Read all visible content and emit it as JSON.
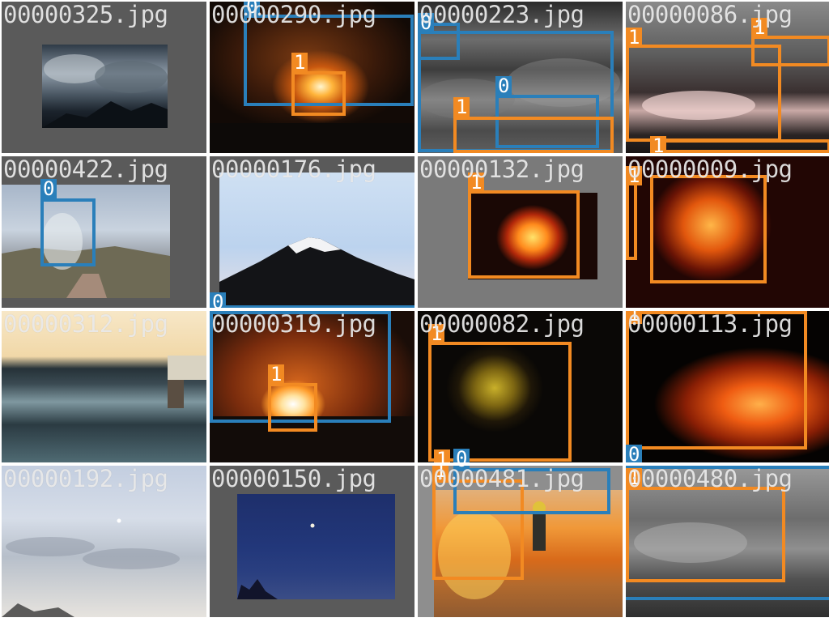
{
  "colors": {
    "class_1": "#f28a22",
    "class_0": "#2a7fba",
    "pad": "#5a5a5a"
  },
  "tiles": [
    {
      "name": "00000325.jpg",
      "labels": []
    },
    {
      "name": "00000290.jpg",
      "labels": [
        "0",
        "1"
      ]
    },
    {
      "name": "00000223.jpg",
      "labels": [
        "0",
        "0",
        "1"
      ]
    },
    {
      "name": "00000086.jpg",
      "labels": [
        "1",
        "1",
        "1"
      ]
    },
    {
      "name": "00000422.jpg",
      "labels": [
        "0"
      ]
    },
    {
      "name": "00000176.jpg",
      "labels": [
        "0"
      ]
    },
    {
      "name": "00000132.jpg",
      "labels": [
        "1"
      ]
    },
    {
      "name": "00000009.jpg",
      "labels": [
        "1"
      ]
    },
    {
      "name": "00000312.jpg",
      "labels": []
    },
    {
      "name": "00000319.jpg",
      "labels": [
        "1"
      ]
    },
    {
      "name": "00000082.jpg",
      "labels": [
        "1",
        "1",
        "0"
      ]
    },
    {
      "name": "00000113.jpg",
      "labels": [
        "1",
        "0"
      ]
    },
    {
      "name": "00000192.jpg",
      "labels": []
    },
    {
      "name": "00000150.jpg",
      "labels": []
    },
    {
      "name": "00000481.jpg",
      "labels": [
        "1",
        "0"
      ]
    },
    {
      "name": "00000480.jpg",
      "labels": [
        "1",
        "0"
      ]
    }
  ]
}
